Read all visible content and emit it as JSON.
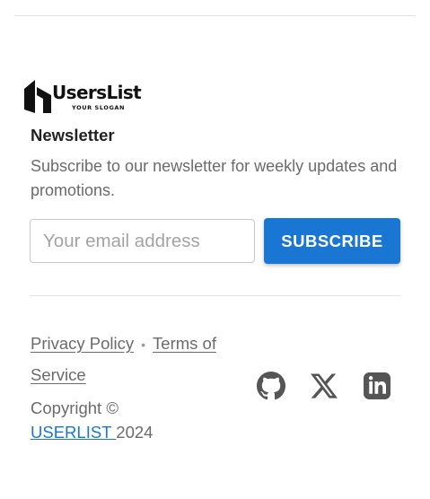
{
  "brand": {
    "name": "UsersList",
    "slogan": "YOUR SLOGAN"
  },
  "newsletter": {
    "heading": "Newsletter",
    "description": "Subscribe to our newsletter for weekly updates and promotions.",
    "email_placeholder": "Your email address",
    "subscribe_label": "SUBSCRIBE"
  },
  "footer": {
    "privacy_label": "Privacy Policy",
    "separator": "•",
    "terms_label": "Terms of Service",
    "copyright_prefix": "Copyright ©",
    "copyright_link": "USERLIST ",
    "copyright_year": "2024"
  },
  "social": [
    {
      "icon": "github-icon"
    },
    {
      "icon": "x-icon"
    },
    {
      "icon": "linkedin-icon"
    }
  ],
  "colors": {
    "accent": "#1976d2",
    "muted_text": "#6b6b6b",
    "icon": "#555555"
  }
}
